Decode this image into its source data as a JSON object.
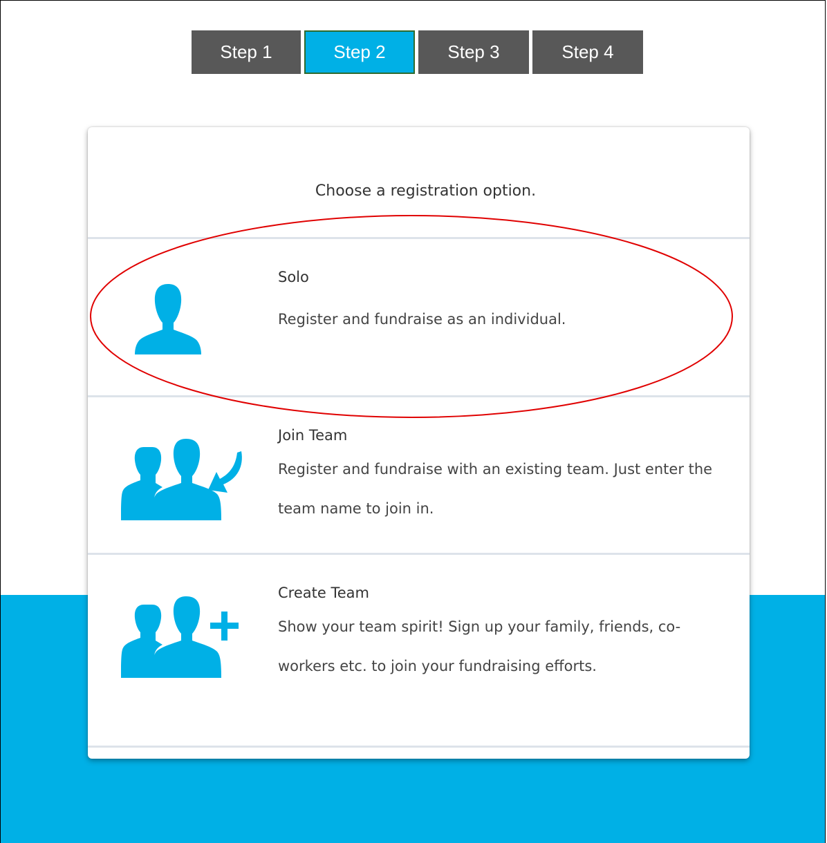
{
  "steps": [
    {
      "label": "Step 1",
      "active": false
    },
    {
      "label": "Step 2",
      "active": true
    },
    {
      "label": "Step 3",
      "active": false
    },
    {
      "label": "Step 4",
      "active": false
    }
  ],
  "card": {
    "prompt": "Choose a registration option.",
    "options": [
      {
        "title": "Solo",
        "description": "Register and fundraise as an individual.",
        "icon": "person-icon"
      },
      {
        "title": "Join Team",
        "description": "Register and fundraise with an existing team. Just enter the team name to join in.",
        "icon": "team-join-icon"
      },
      {
        "title": "Create Team",
        "description": "Show your team spirit! Sign up your family, friends, co-workers etc. to join your fundraising efforts.",
        "icon": "team-create-icon"
      }
    ]
  },
  "colors": {
    "accent": "#00b0e6",
    "step_inactive": "#585858",
    "annotation": "#e00000"
  }
}
